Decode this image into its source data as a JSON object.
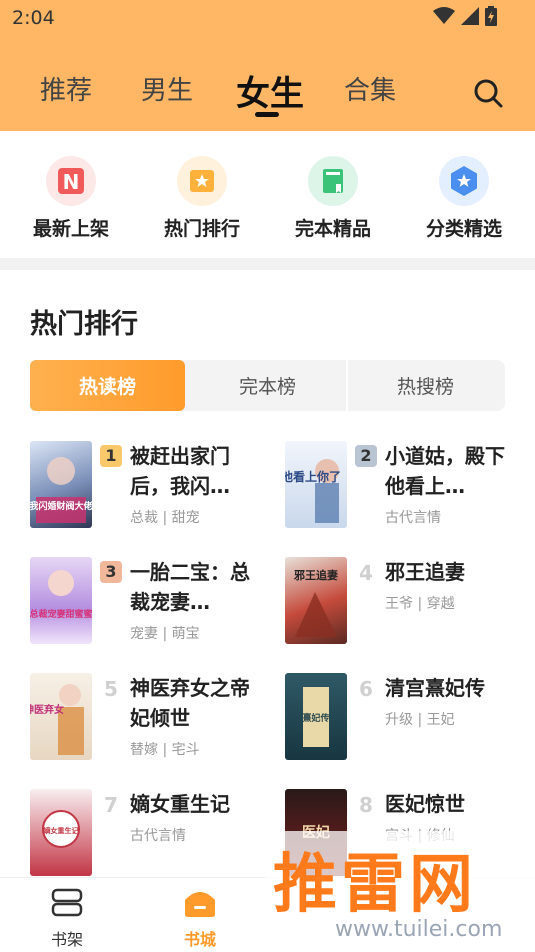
{
  "status_bar": {
    "time": "2:04"
  },
  "top_tabs": [
    {
      "label": "推荐"
    },
    {
      "label": "男生"
    },
    {
      "label": "女生",
      "active": true
    },
    {
      "label": "合集"
    }
  ],
  "quick_entries": [
    {
      "label": "最新上架",
      "icon": "new-shelf-icon",
      "color": "#f05a5a"
    },
    {
      "label": "热门排行",
      "icon": "hot-rank-icon",
      "color": "#ffb13c"
    },
    {
      "label": "完本精品",
      "icon": "book-icon",
      "color": "#3cc37a"
    },
    {
      "label": "分类精选",
      "icon": "category-star-icon",
      "color": "#4a8ff0"
    }
  ],
  "section": {
    "title": "热门排行"
  },
  "rank_tabs": [
    {
      "label": "热读榜",
      "active": true
    },
    {
      "label": "完本榜"
    },
    {
      "label": "热搜榜"
    }
  ],
  "books": [
    {
      "rank": "1",
      "title": "被赶出家门后，我闪…",
      "tags": "总裁 | 甜宠",
      "cover_text": "我闪婚财阀大佬"
    },
    {
      "rank": "2",
      "title": "小道姑，殿下他看上…",
      "tags": "古代言情",
      "cover_text": "殿下他看上你了"
    },
    {
      "rank": "3",
      "title": "一胎二宝：总裁宠妻…",
      "tags": "宠妻 | 萌宝",
      "cover_text": "总裁宠妻甜蜜蜜"
    },
    {
      "rank": "4",
      "title": "邪王追妻",
      "tags": "王爷 | 穿越",
      "cover_text": "邪王追妻"
    },
    {
      "rank": "5",
      "title": "神医弃女之帝妃倾世",
      "tags": "替嫁 | 宅斗",
      "cover_text": "神医弃女"
    },
    {
      "rank": "6",
      "title": "清宫熹妃传",
      "tags": "升级 | 王妃",
      "cover_text": "熹妃传"
    },
    {
      "rank": "7",
      "title": "嫡女重生记",
      "tags": "古代言情",
      "cover_text": "嫡女重生记"
    },
    {
      "rank": "8",
      "title": "医妃惊世",
      "tags": "宫斗 | 修仙",
      "cover_text": "医妃"
    }
  ],
  "bottom_nav": [
    {
      "label": "书架",
      "icon": "bookshelf-icon"
    },
    {
      "label": "书城",
      "icon": "bookstore-icon",
      "active": true
    }
  ],
  "watermark": {
    "big": "推雷网",
    "small": "www.tuilei.com"
  },
  "colors": {
    "accent": "#ff9b2b",
    "header_bg": "#ffb766"
  }
}
